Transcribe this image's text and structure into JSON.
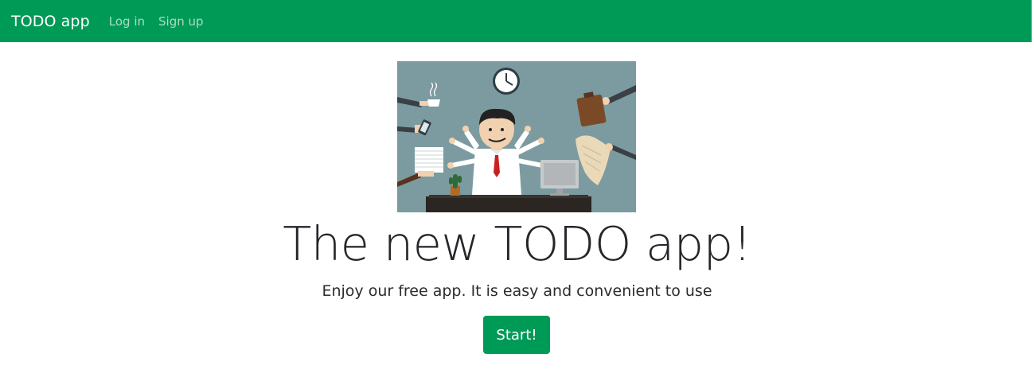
{
  "navbar": {
    "brand": "TODO app",
    "links": [
      {
        "label": "Log in"
      },
      {
        "label": "Sign up"
      }
    ]
  },
  "hero": {
    "title": "The new TODO app!",
    "subtitle": "Enjoy our free app. It is easy and convenient to use",
    "button_label": "Start!"
  },
  "colors": {
    "brand_green": "#009a57",
    "illustration_bg": "#7b9ba0"
  }
}
